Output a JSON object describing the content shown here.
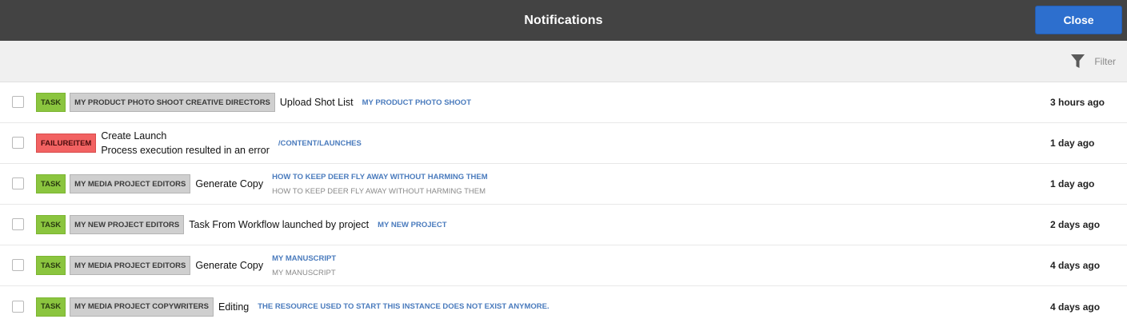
{
  "header": {
    "title": "Notifications",
    "close_label": "Close"
  },
  "filter": {
    "label": "Filter",
    "icon": "funnel-icon"
  },
  "colors": {
    "header_bg": "#434343",
    "close_bg": "#2d6fce",
    "task": "#8bc53f",
    "failure": "#f26262",
    "group": "#cfcfcf",
    "link": "#4a7bbd"
  },
  "rows": [
    {
      "type": "TASK",
      "group": "MY PRODUCT PHOTO SHOOT CREATIVE DIRECTORS",
      "title": "Upload Shot List",
      "link": "MY PRODUCT PHOTO SHOOT",
      "time": "3 hours ago"
    },
    {
      "type": "FAILUREITEM",
      "title": "Create Launch",
      "subtitle": "Process execution resulted in an error",
      "link": "/CONTENT/LAUNCHES",
      "time": "1 day ago"
    },
    {
      "type": "TASK",
      "group": "MY MEDIA PROJECT EDITORS",
      "title": "Generate Copy",
      "link": "HOW TO KEEP DEER FLY AWAY WITHOUT HARMING THEM",
      "link_sub": "HOW TO KEEP DEER FLY AWAY WITHOUT HARMING THEM",
      "time": "1 day ago"
    },
    {
      "type": "TASK",
      "group": "MY NEW PROJECT EDITORS",
      "title": "Task From Workflow launched by project",
      "link": "MY NEW PROJECT",
      "time": "2 days ago"
    },
    {
      "type": "TASK",
      "group": "MY MEDIA PROJECT EDITORS",
      "title": "Generate Copy",
      "link": "MY MANUSCRIPT",
      "link_sub": "MY MANUSCRIPT",
      "time": "4 days ago"
    },
    {
      "type": "TASK",
      "group": "MY MEDIA PROJECT COPYWRITERS",
      "title": "Editing",
      "link": "THE RESOURCE USED TO START THIS INSTANCE DOES NOT EXIST ANYMORE.",
      "time": "4 days ago"
    }
  ]
}
